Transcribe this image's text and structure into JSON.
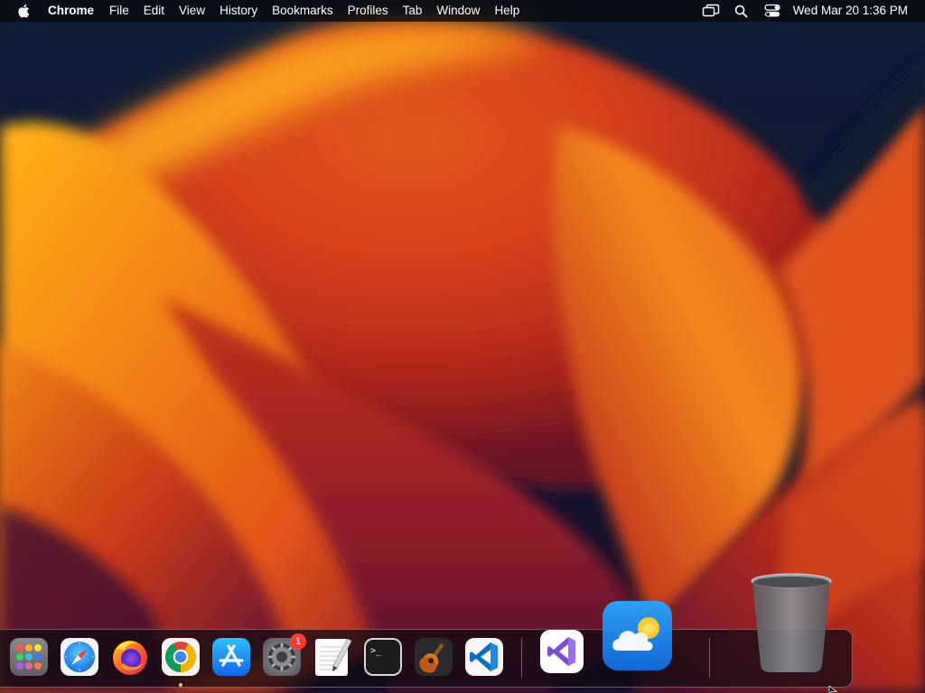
{
  "menubar": {
    "app_name": "Chrome",
    "menus": [
      "File",
      "Edit",
      "View",
      "History",
      "Bookmarks",
      "Profiles",
      "Tab",
      "Window",
      "Help"
    ],
    "status_icons": [
      "screen-mirroring-icon",
      "search-icon",
      "control-center-icon"
    ],
    "clock": "Wed Mar 20  1:36 PM"
  },
  "dock": {
    "apps": [
      {
        "name": "Launchpad",
        "icon": "launchpad-icon",
        "running": false
      },
      {
        "name": "Safari",
        "icon": "safari-icon",
        "running": false
      },
      {
        "name": "Firefox",
        "icon": "firefox-icon",
        "running": false
      },
      {
        "name": "Google Chrome",
        "icon": "chrome-icon",
        "running": true
      },
      {
        "name": "App Store",
        "icon": "app-store-icon",
        "running": false
      },
      {
        "name": "System Settings",
        "icon": "system-settings-icon",
        "running": false,
        "badge": "1"
      },
      {
        "name": "TextEdit",
        "icon": "textedit-icon",
        "running": false
      },
      {
        "name": "Terminal",
        "icon": "terminal-icon",
        "running": false
      },
      {
        "name": "GarageBand",
        "icon": "garageband-icon",
        "running": false
      },
      {
        "name": "Visual Studio Code",
        "icon": "vscode-icon",
        "running": false
      },
      {
        "name": "Visual Studio",
        "icon": "visual-studio-icon",
        "running": false
      },
      {
        "name": "Weather",
        "icon": "weather-icon",
        "running": false
      },
      {
        "name": "Trash",
        "icon": "trash-icon",
        "running": false
      }
    ]
  },
  "colors": {
    "wallpaper_dark": "#0b1a33",
    "wallpaper_orange": "#f07a10",
    "wallpaper_red": "#c8321a",
    "wallpaper_magenta": "#7a1a3a",
    "badge_red": "#ff3b30"
  }
}
